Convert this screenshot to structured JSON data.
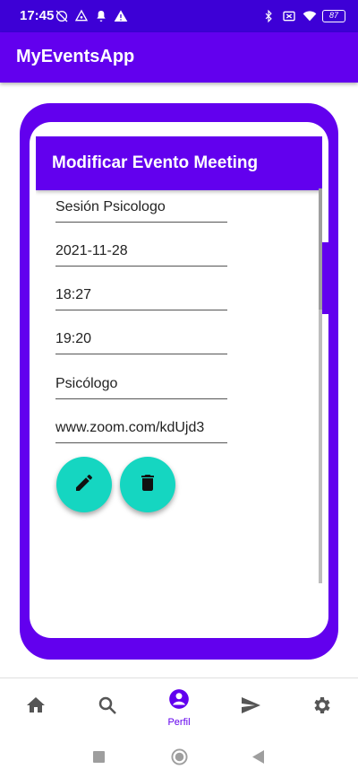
{
  "status_bar": {
    "time": "17:45",
    "battery": "87",
    "left_icons": [
      "muted-alarm-icon",
      "data-saver-icon",
      "notification-bell-icon",
      "warning-icon",
      "warning-icon"
    ],
    "right_icons": [
      "bluetooth-icon",
      "no-sim-icon",
      "wifi-icon",
      "battery-icon"
    ]
  },
  "app_bar": {
    "title": "MyEventsApp"
  },
  "card": {
    "title": "Modificar Evento Meeting",
    "fields": [
      {
        "name": "event-name-field",
        "value": "Sesión Psicologo"
      },
      {
        "name": "event-date-field",
        "value": "2021-11-28"
      },
      {
        "name": "start-time-field",
        "value": "18:27"
      },
      {
        "name": "end-time-field",
        "value": "19:20"
      },
      {
        "name": "category-field",
        "value": "Psicólogo"
      },
      {
        "name": "link-field",
        "value": "www.zoom.com/kdUjd3"
      }
    ]
  },
  "bottom_nav": {
    "items": [
      {
        "icon": "home-icon",
        "label": ""
      },
      {
        "icon": "search-icon",
        "label": ""
      },
      {
        "icon": "profile-icon",
        "label": "Perfil",
        "active": true
      },
      {
        "icon": "send-icon",
        "label": ""
      },
      {
        "icon": "settings-icon",
        "label": ""
      }
    ]
  },
  "colors": {
    "status_bar": "#3d00d6",
    "primary": "#6200ee",
    "fab": "#15d6c1",
    "nav_inactive": "#555555",
    "nav_active": "#6200ee"
  }
}
